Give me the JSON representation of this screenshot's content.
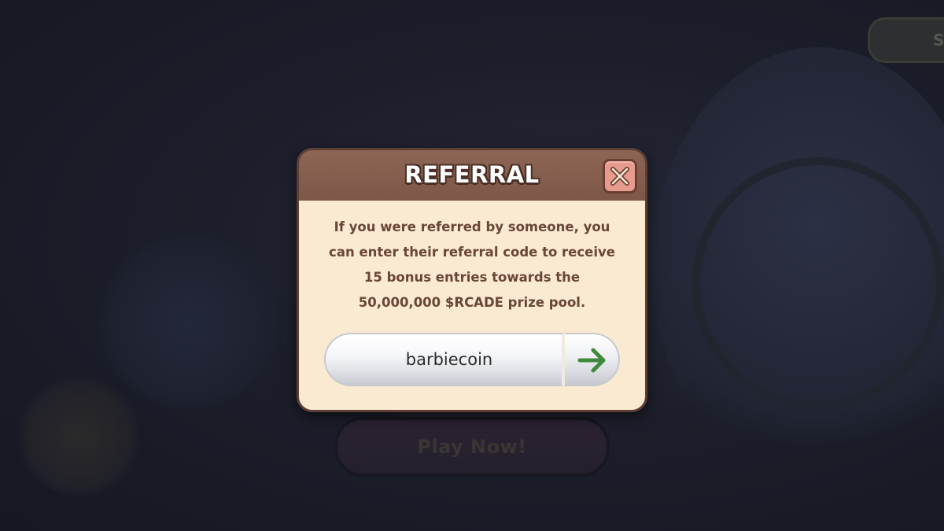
{
  "modal": {
    "title": "REFERRAL",
    "description": "If you were referred by someone, you can enter their referral code to receive 15 bonus entries towards the 50,000,000 $RCADE prize pool.",
    "referral_code_value": "barbiecoin",
    "close_icon": "close-icon",
    "submit_icon": "arrow-right-icon"
  },
  "background": {
    "play_button_label": "Play Now!",
    "corner_button_label": "St"
  },
  "colors": {
    "header": "#7d5748",
    "body": "#f9ead1",
    "close_button": "#e79a8e",
    "arrow": "#3f8a3c",
    "text": "#6a4638"
  }
}
